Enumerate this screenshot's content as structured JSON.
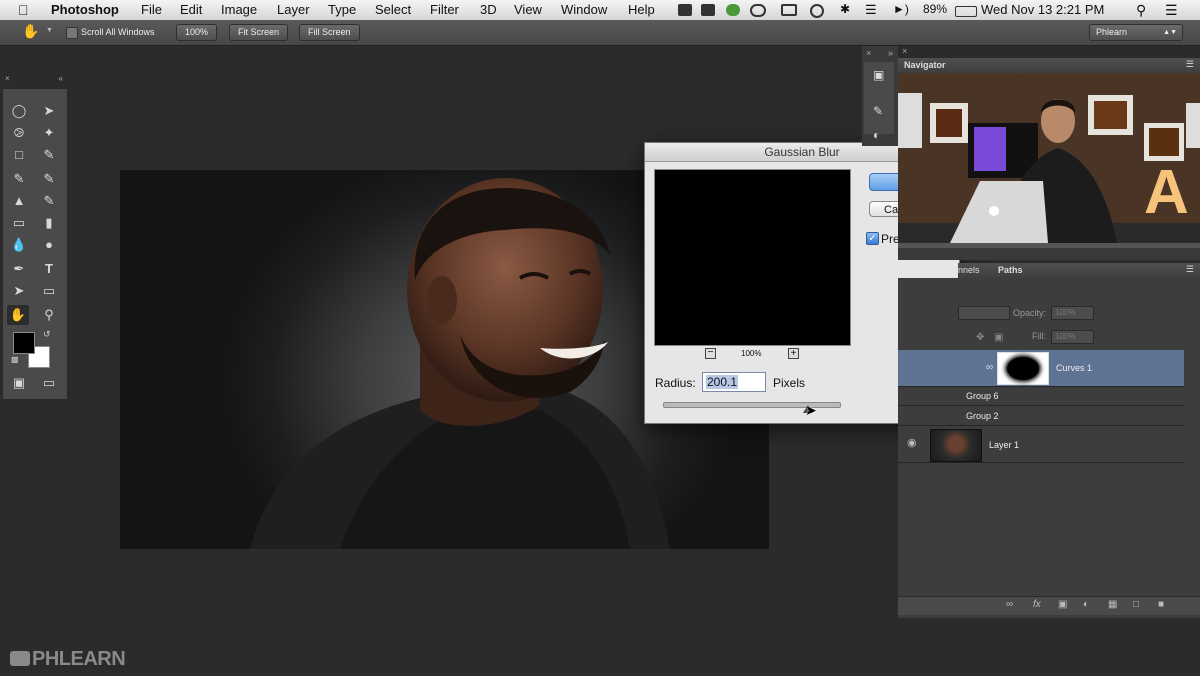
{
  "menubar": {
    "apple": "",
    "app_name": "Photoshop",
    "items": [
      "File",
      "Edit",
      "Image",
      "Layer",
      "Type",
      "Select",
      "Filter",
      "3D",
      "View",
      "Window",
      "Help"
    ],
    "battery": "89%",
    "datetime": "Wed Nov 13  2:21 PM"
  },
  "options_bar": {
    "scroll_all_windows": "Scroll All Windows",
    "btn_100": "100%",
    "btn_fit": "Fit Screen",
    "btn_fill": "Fill Screen",
    "workspace": "Phlearn"
  },
  "dialog": {
    "title": "Gaussian Blur",
    "zoom": "100%",
    "radius_label": "Radius:",
    "radius_value": "200.1",
    "units": "Pixels",
    "cancel_partial": "Ca",
    "preview_partial": "Pre",
    "preview_checked": true
  },
  "navigator": {
    "title": "Navigator"
  },
  "layers_panel": {
    "tabs": [
      "nnels",
      "Paths"
    ],
    "opacity_label": "Opacity:",
    "opacity_value": "100%",
    "fill_label": "Fill:",
    "fill_value": "100%",
    "layers": [
      {
        "name": "Curves 1",
        "selected": true
      },
      {
        "name": "Group 6"
      },
      {
        "name": "Group 2"
      },
      {
        "name": "Layer 1"
      }
    ]
  },
  "watermark": "PHLEARN",
  "colors": {
    "accent_selection": "#5f7394",
    "ps_bg": "#2b2b2b"
  }
}
